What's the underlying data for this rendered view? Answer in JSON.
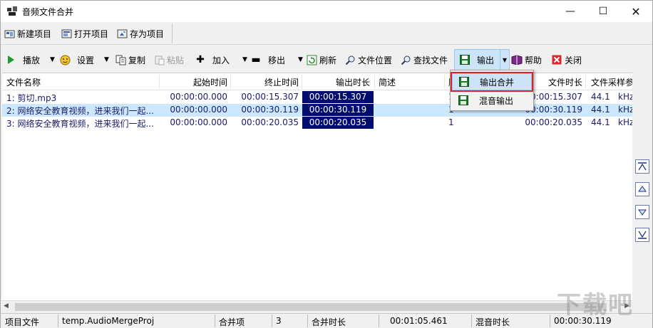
{
  "window": {
    "title": "音频文件合并"
  },
  "project_bar": {
    "new_label": "新建项目",
    "open_label": "打开项目",
    "save_label": "存为项目"
  },
  "toolbar": {
    "play_label": "播放",
    "settings_label": "设置",
    "copy_label": "复制",
    "paste_label": "粘贴",
    "add_label": "加入",
    "remove_label": "移出",
    "refresh_label": "刷新",
    "file_location_label": "文件位置",
    "find_file_label": "查找文件",
    "output_label": "输出",
    "help_label": "帮助",
    "close_label": "关闭"
  },
  "output_menu": {
    "items": [
      {
        "label": "输出合并"
      },
      {
        "label": "混音输出"
      }
    ]
  },
  "table": {
    "columns": {
      "name": "文件名称",
      "start": "起始时间",
      "end": "终止时间",
      "output_duration": "输出时长",
      "description": "简述",
      "hidden_col": "顺",
      "file_duration": "文件时长",
      "sample_rate": "文件采样参"
    },
    "rows": [
      {
        "name": "1: 剪切.mp3",
        "start": "00:00:00.000",
        "end": "00:00:15.307",
        "output_duration": "00:00:15.307",
        "description": "",
        "order": "1",
        "file_duration": "00:00:15.307",
        "sample_rate": "44.1",
        "sample_unit": "kHz"
      },
      {
        "name": "2: 网络安全教育视频，进来我们一起...",
        "start": "00:00:00.000",
        "end": "00:00:30.119",
        "output_duration": "00:00:30.119",
        "description": "",
        "order": "1",
        "file_duration": "00:00:30.119",
        "sample_rate": "44.1",
        "sample_unit": "kHz"
      },
      {
        "name": "3: 网络安全教育视频，进来我们一起...",
        "start": "00:00:00.000",
        "end": "00:00:20.035",
        "output_duration": "00:00:20.035",
        "description": "",
        "order": "1",
        "file_duration": "00:00:20.035",
        "sample_rate": "44.1",
        "sample_unit": "kHz"
      }
    ]
  },
  "statusbar": {
    "project_file_label": "项目文件",
    "project_file_value": "temp.AudioMergeProj",
    "merge_items_label": "合并项",
    "merge_items_value": "3",
    "merge_duration_label": "合并时长",
    "merge_duration_value": "00:01:05.461",
    "mix_duration_label": "混音时长",
    "mix_duration_value": "00:00:30.119"
  },
  "watermark": {
    "text": "下载吧"
  },
  "colors": {
    "selection": "#cce8ff",
    "output_cell": "#000c6e",
    "menu_highlight_border": "#d9262c"
  }
}
